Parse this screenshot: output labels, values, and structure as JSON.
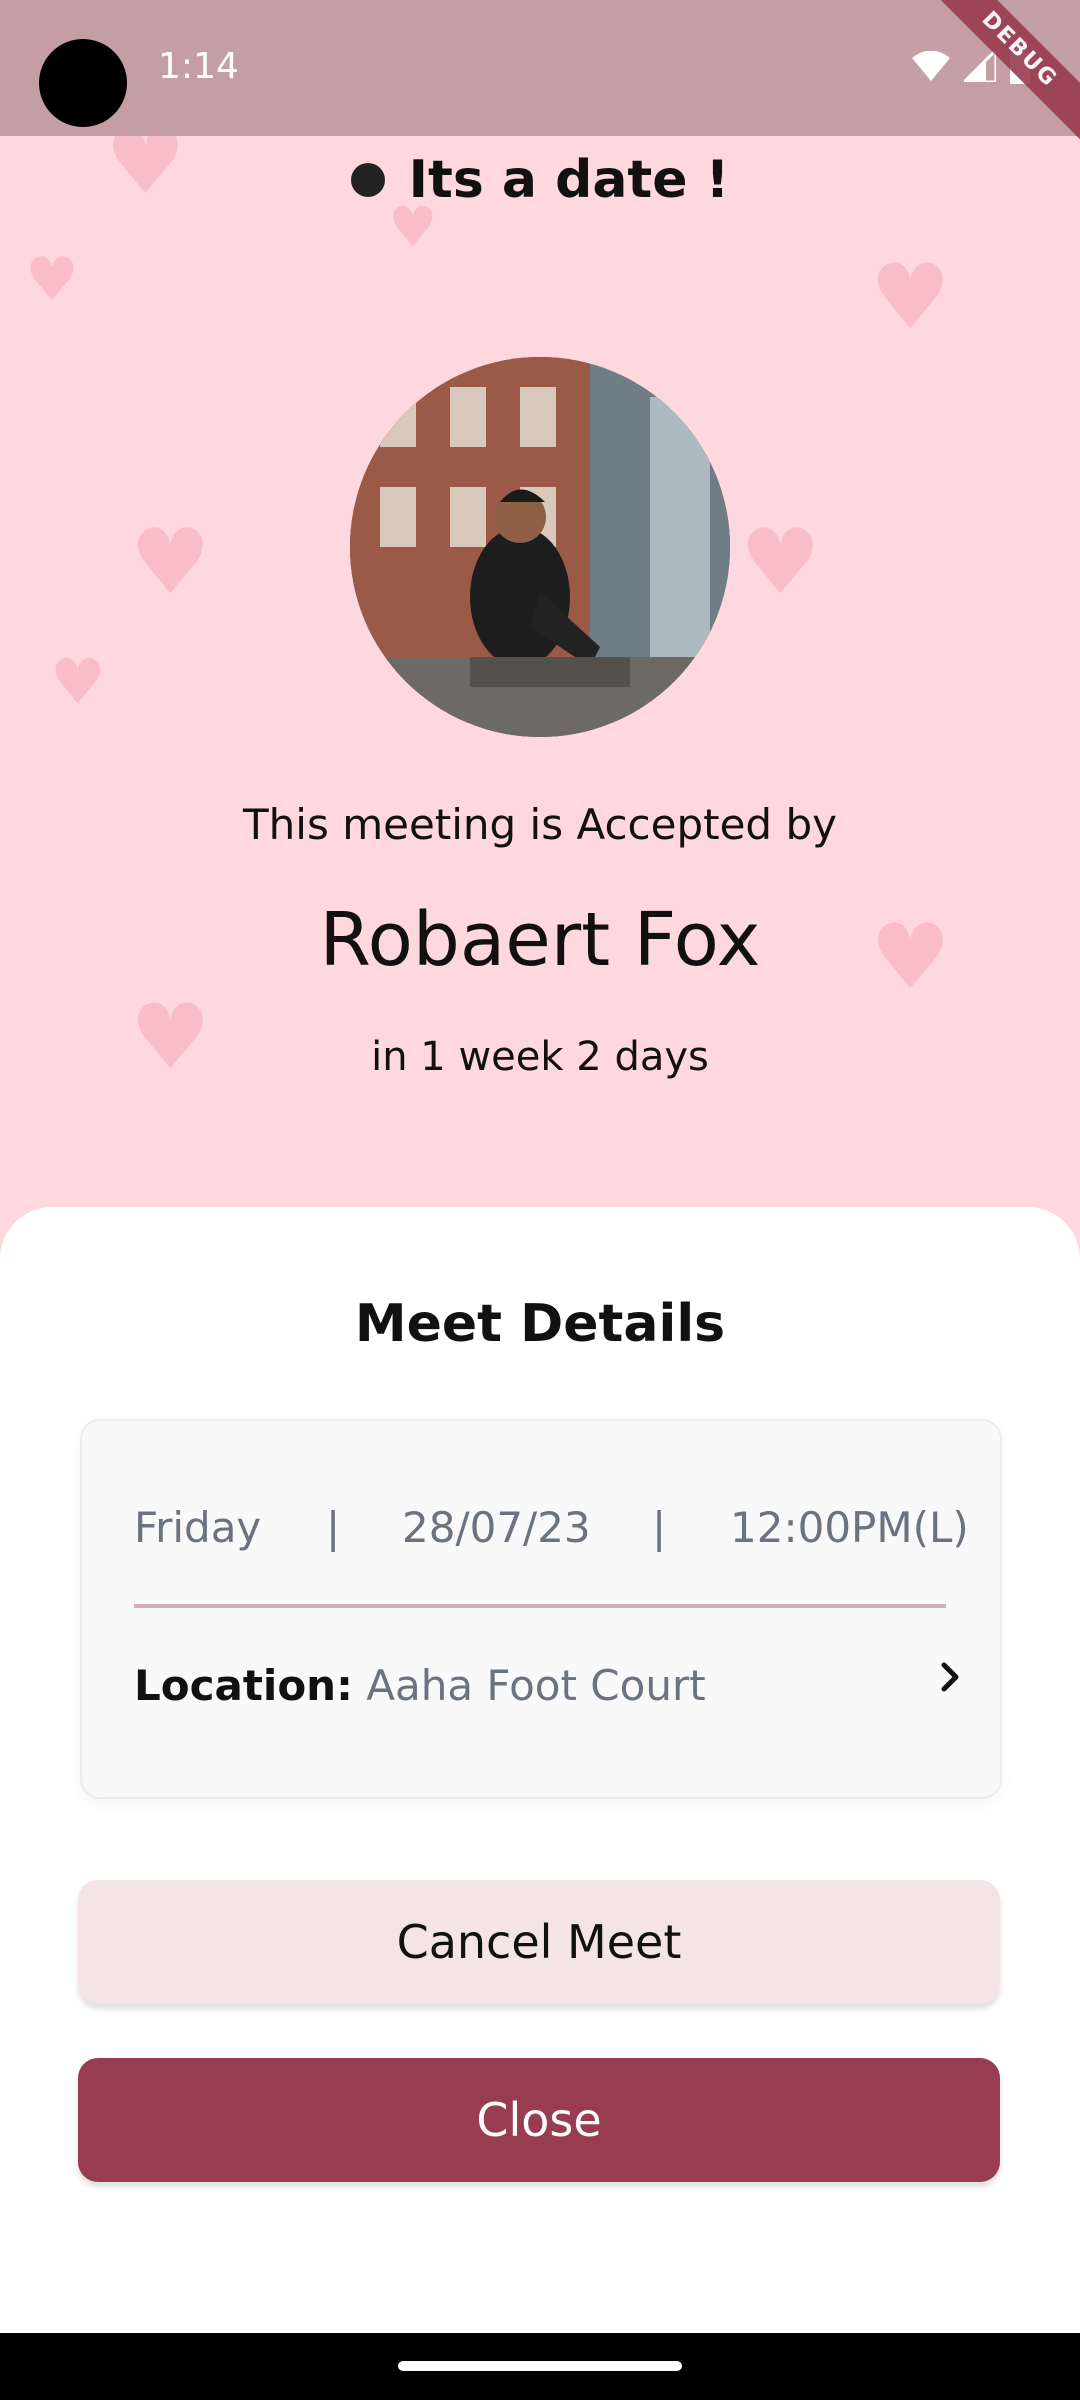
{
  "status_bar": {
    "time": "1:14",
    "debug_label": "DEBUG"
  },
  "header": {
    "title": "Its a date !"
  },
  "profile": {
    "accepted_text": "This meeting is Accepted by",
    "name": "Robaert Fox",
    "relative_time": "in 1 week 2 days"
  },
  "details": {
    "title": "Meet Details",
    "day": "Friday",
    "separator": "|",
    "date": "28/07/23",
    "time": "12:00PM(L)",
    "location_label": "Location:",
    "location_value": "Aaha Foot Court"
  },
  "actions": {
    "cancel_label": "Cancel Meet",
    "close_label": "Close"
  },
  "colors": {
    "background": "#ffd7de",
    "accent": "#983d50",
    "cancel_bg": "#f5e4e5",
    "status_bar": "#c39ea5"
  },
  "icons": [
    "wifi-icon",
    "signal-icon",
    "battery-icon",
    "heart-icon",
    "chevron-right-icon"
  ]
}
